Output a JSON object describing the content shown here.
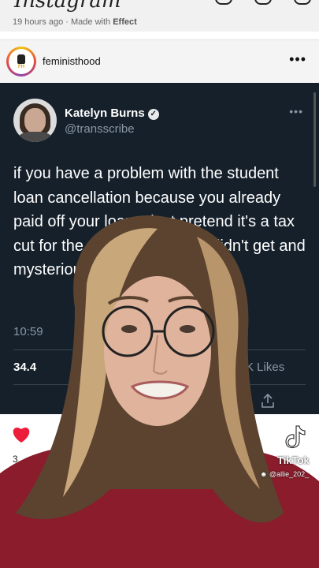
{
  "instagram": {
    "logo": "Instagram",
    "post_meta": {
      "age": "19 hours ago",
      "separator": "·",
      "made_with": "Made with",
      "effect": "Effect"
    },
    "username": "feministhood",
    "more": "•••",
    "likes_partial": "3.",
    "avatar_initials": "FH"
  },
  "tweet": {
    "name": "Katelyn Burns",
    "verified": "✓",
    "handle": "@transscribe",
    "more": "•••",
    "text": "if you have a problem with the student loan cancellation because you already paid off your loans, just pretend it's a tax cut for the rich that you also didn't get and mysteriously didn't care about",
    "time": "10:59",
    "retweets": "34.4",
    "likes_label": "K Likes"
  },
  "tiktok": {
    "brand": "TikTok",
    "user": "@allie_202_"
  },
  "colors": {
    "tweet_bg": "#15202b",
    "heart": "#ed1c3a",
    "sweater": "#8a1c2b"
  }
}
